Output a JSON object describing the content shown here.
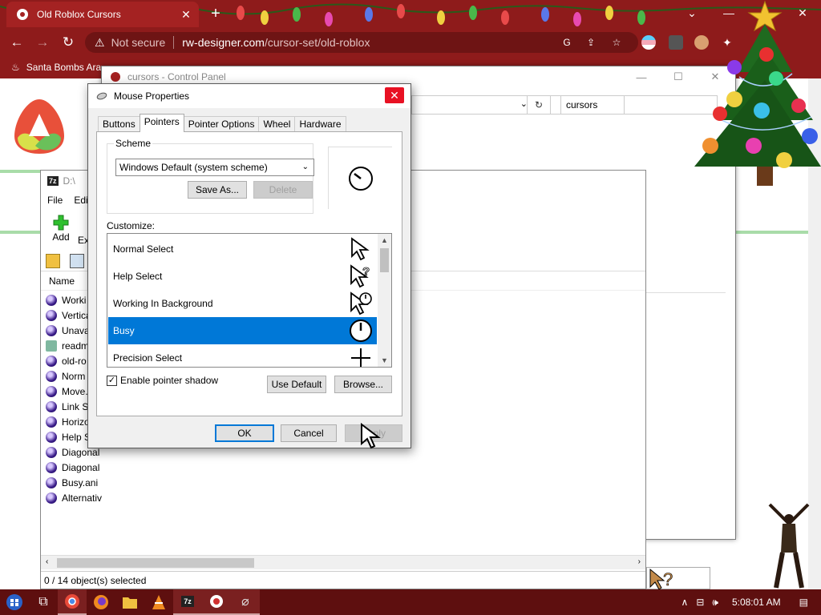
{
  "browser": {
    "tab_title": "Old Roblox Cursors",
    "tab_close": "✕",
    "new_tab": "+",
    "security_label": "Not secure",
    "url_host": "rw-designer.com",
    "url_path": "/cursor-set/old-roblox",
    "bookmark_label": "Santa Bombs Ara",
    "window_minimize": "—",
    "window_restore": "❐",
    "window_close": "✕"
  },
  "control_panel": {
    "title": "cursors - Control Panel",
    "search_value": "cursors",
    "minimize": "—",
    "restore": "☐",
    "close": "✕"
  },
  "zip": {
    "title": "D:\\",
    "menu": [
      "File",
      "Edi"
    ],
    "add_label": "Add",
    "ext_label": "Ex",
    "column_name": "Name",
    "files": [
      {
        "name": "Worki",
        "type": "cursor"
      },
      {
        "name": "Vertica",
        "type": "cursor"
      },
      {
        "name": "Unava",
        "type": "cursor"
      },
      {
        "name": "readm",
        "type": "doc"
      },
      {
        "name": "old-ro",
        "type": "cursor"
      },
      {
        "name": "Norm",
        "type": "cursor"
      },
      {
        "name": "Move.",
        "type": "cursor"
      },
      {
        "name": "Link S",
        "type": "cursor"
      },
      {
        "name": "Horizo",
        "type": "cursor"
      },
      {
        "name": "Help S",
        "type": "cursor"
      },
      {
        "name": "Diagonal",
        "type": "cursor"
      },
      {
        "name": "Diagonal",
        "type": "cursor"
      },
      {
        "name": "Busy.ani",
        "type": "cursor"
      },
      {
        "name": "Alternativ",
        "type": "cursor"
      }
    ],
    "status": "0 / 14 object(s) selected"
  },
  "dialog": {
    "title": "Mouse Properties",
    "close": "✕",
    "tabs": [
      "Buttons",
      "Pointers",
      "Pointer Options",
      "Wheel",
      "Hardware"
    ],
    "active_tab": "Pointers",
    "scheme_label": "Scheme",
    "scheme_value": "Windows Default (system scheme)",
    "save_as": "Save As...",
    "delete": "Delete",
    "customize_label": "Customize:",
    "cursors": [
      {
        "name": "Normal Select",
        "icon": "arrow-cursor-icon"
      },
      {
        "name": "Help Select",
        "icon": "help-cursor-icon"
      },
      {
        "name": "Working In Background",
        "icon": "working-cursor-icon"
      },
      {
        "name": "Busy",
        "icon": "busy-cursor-icon",
        "selected": true
      },
      {
        "name": "Precision Select",
        "icon": "crosshair-cursor-icon"
      }
    ],
    "shadow_label": "Enable pointer shadow",
    "shadow_checked": true,
    "use_default": "Use Default",
    "browse": "Browse...",
    "ok": "OK",
    "cancel": "Cancel",
    "apply": "Apply"
  },
  "taskbar": {
    "time": "5:08:01 AM",
    "apps": [
      "start",
      "task-view",
      "chrome",
      "firefox",
      "file-explorer",
      "vlc",
      "7zip",
      "roblox",
      "paperclip"
    ]
  },
  "colors": {
    "chrome_bg": "#8e1b1b",
    "selection": "#0078d7",
    "taskbar": "#5e0f0f"
  }
}
